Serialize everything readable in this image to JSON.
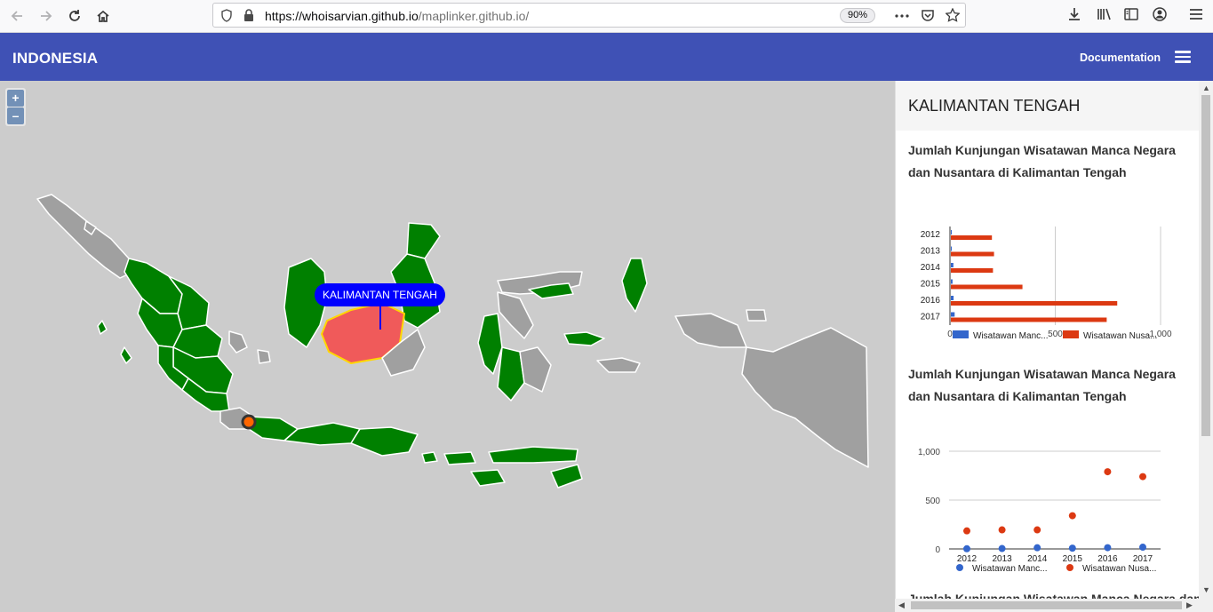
{
  "browser": {
    "url_host": "https://whoisarvian.github.io",
    "url_path": "/maplinker.github.io/",
    "zoom": "90%"
  },
  "header": {
    "title": "INDONESIA",
    "documentation_label": "Documentation"
  },
  "map": {
    "zoom_in": "+",
    "zoom_out": "–",
    "popup_label": "KALIMANTAN TENGAH",
    "colors": {
      "ocean": "#cccccc",
      "highlight": "#008000",
      "inactive": "#a0a0a0",
      "selected": "#f05a5a",
      "selected_border": "#ffd700"
    }
  },
  "sidebar": {
    "title": "KALIMANTAN TENGAH",
    "cut_off_title": "Jumlah Kunjungan Wisatawan Manca Negara dan"
  },
  "chart_data": [
    {
      "type": "bar",
      "orientation": "horizontal",
      "title": "Jumlah Kunjungan Wisatawan Manca Negara dan Nusantara di Kalimantan Tengah",
      "categories": [
        "2012",
        "2013",
        "2014",
        "2015",
        "2016",
        "2017"
      ],
      "xlim": [
        0,
        1000
      ],
      "xticks": [
        "0",
        "500",
        "1,000"
      ],
      "series": [
        {
          "name": "Wisatawan Manc...",
          "color": "#3366cc",
          "values": [
            2,
            4,
            12,
            8,
            13,
            18
          ]
        },
        {
          "name": "Wisatawan Nusa...",
          "color": "#dc3912",
          "values": [
            195,
            205,
            200,
            340,
            790,
            740
          ]
        }
      ],
      "legend": "bottom"
    },
    {
      "type": "scatter",
      "title": "Jumlah Kunjungan Wisatawan Manca Negara dan Nusantara di Kalimantan Tengah",
      "categories": [
        "2012",
        "2013",
        "2014",
        "2015",
        "2016",
        "2017"
      ],
      "ylim": [
        0,
        1000
      ],
      "yticks": [
        "0",
        "500",
        "1,000"
      ],
      "series": [
        {
          "name": "Wisatawan Manc...",
          "color": "#3366cc",
          "values": [
            2,
            4,
            12,
            8,
            13,
            18
          ]
        },
        {
          "name": "Wisatawan Nusa...",
          "color": "#dc3912",
          "values": [
            185,
            195,
            195,
            340,
            790,
            740
          ]
        }
      ],
      "legend": "bottom"
    }
  ]
}
